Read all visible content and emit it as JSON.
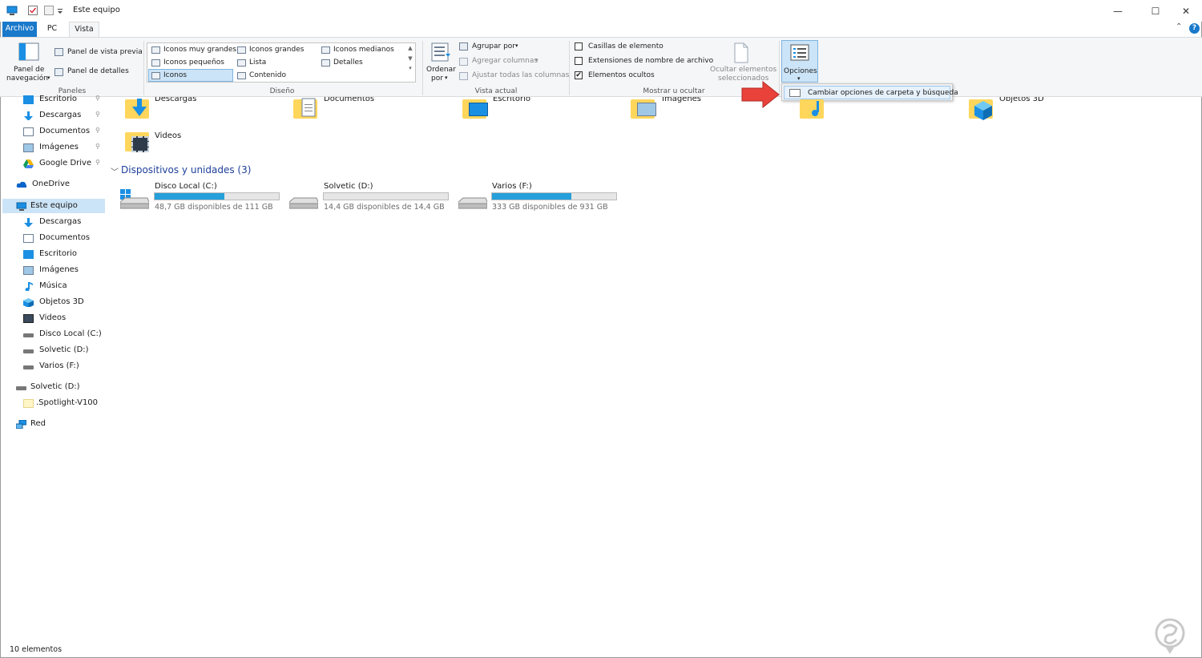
{
  "window": {
    "title": "Este equipo",
    "minimize": "—",
    "maximize": "☐",
    "close": "✕"
  },
  "tabs": {
    "file": "Archivo",
    "pc": "PC",
    "view": "Vista",
    "collapse": "⌃",
    "help": "?"
  },
  "ribbon": {
    "panels": {
      "nav_pane_line1": "Panel de",
      "nav_pane_line2": "navegación",
      "preview_pane": "Panel de vista previa",
      "details_pane": "Panel de detalles",
      "group_label": "Paneles"
    },
    "layout": {
      "items": [
        "Iconos muy grandes",
        "Iconos grandes",
        "Iconos medianos",
        "Iconos pequeños",
        "Lista",
        "Detalles",
        "Iconos",
        "Contenido"
      ],
      "selected": "Iconos",
      "group_label": "Diseño"
    },
    "current_view": {
      "sort_line1": "Ordenar",
      "sort_line2": "por",
      "group_by": "Agrupar por",
      "add_columns": "Agregar columnas",
      "fit_columns": "Ajustar todas las columnas",
      "group_label": "Vista actual"
    },
    "show_hide": {
      "item_checkboxes": "Casillas de elemento",
      "item_checkboxes_checked": false,
      "file_extensions": "Extensiones de nombre de archivo",
      "file_extensions_checked": false,
      "hidden_items": "Elementos ocultos",
      "hidden_items_checked": true,
      "hide_selected_line1": "Ocultar elementos",
      "hide_selected_line2": "seleccionados",
      "group_label": "Mostrar u ocultar"
    },
    "options": {
      "label": "Opciones"
    }
  },
  "dropdown": {
    "item": "Cambiar opciones de carpeta y búsqueda"
  },
  "nav": {
    "quick_access": [
      {
        "label": "Escritorio",
        "pinned": true
      },
      {
        "label": "Descargas",
        "pinned": true
      },
      {
        "label": "Documentos",
        "pinned": true
      },
      {
        "label": "Imágenes",
        "pinned": true
      },
      {
        "label": "Google Drive",
        "pinned": true
      }
    ],
    "onedrive": "OneDrive",
    "this_pc": "Este equipo",
    "this_pc_items": [
      "Descargas",
      "Documentos",
      "Escritorio",
      "Imágenes",
      "Música",
      "Objetos 3D",
      "Videos",
      "Disco Local (C:)",
      "Solvetic (D:)",
      "Varios (F:)"
    ],
    "solvetic_drive": "Solvetic (D:)",
    "spotlight": ".Spotlight-V100",
    "network": "Red",
    "pin_glyph": "📌"
  },
  "content": {
    "folders_row1": [
      "Descargas",
      "Documentos",
      "Escritorio",
      "Imágenes",
      "Objetos 3D"
    ],
    "videos": "Videos",
    "devices_section": "Dispositivos y unidades (3)",
    "drives": [
      {
        "name": "Disco Local (C:)",
        "free": "48,7 GB disponibles de 111 GB",
        "used_fraction": 0.56
      },
      {
        "name": "Solvetic (D:)",
        "free": "14,4 GB disponibles de 14,4 GB",
        "used_fraction": 0.0
      },
      {
        "name": "Varios (F:)",
        "free": "333 GB disponibles de 931 GB",
        "used_fraction": 0.64
      }
    ]
  },
  "status": {
    "count": "10 elementos"
  },
  "colors": {
    "accent": "#1979ca",
    "selection": "#cce4f7",
    "drive_fill": "#26a0da",
    "arrow": "#e8423b",
    "section_title": "#1e3f9b"
  }
}
